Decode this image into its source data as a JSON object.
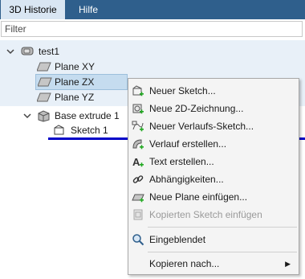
{
  "tabs": [
    {
      "label": "3D Historie"
    },
    {
      "label": "Hilfe"
    }
  ],
  "filter": {
    "placeholder": "Filter",
    "value": ""
  },
  "tree": {
    "root": {
      "label": "test1"
    },
    "planes": [
      {
        "label": "Plane XY"
      },
      {
        "label": "Plane ZX"
      },
      {
        "label": "Plane YZ"
      }
    ],
    "extrude": {
      "label": "Base extrude 1"
    },
    "sketch": {
      "label": "Sketch 1"
    }
  },
  "menu": {
    "items": [
      {
        "label": "Neuer Sketch...",
        "icon": "new-sketch-icon",
        "enabled": true
      },
      {
        "label": "Neue 2D-Zeichnung...",
        "icon": "new-2d-drawing-icon",
        "enabled": true
      },
      {
        "label": "Neuer Verlaufs-Sketch...",
        "icon": "path-sketch-icon",
        "enabled": true
      },
      {
        "label": "Verlauf erstellen...",
        "icon": "create-sweep-icon",
        "enabled": true
      },
      {
        "label": "Text erstellen...",
        "icon": "create-text-icon",
        "enabled": true
      },
      {
        "label": "Abhängigkeiten...",
        "icon": "dependencies-icon",
        "enabled": true
      },
      {
        "label": "Neue Plane einfügen...",
        "icon": "insert-plane-icon",
        "enabled": true
      },
      {
        "label": "Kopierten Sketch einfügen",
        "icon": "paste-sketch-icon",
        "enabled": false
      }
    ],
    "visible_item": {
      "label": "Eingeblendet",
      "icon": "visibility-icon"
    },
    "copy_item": {
      "label": "Kopieren nach...",
      "icon": "submenu-arrow-icon"
    }
  }
}
